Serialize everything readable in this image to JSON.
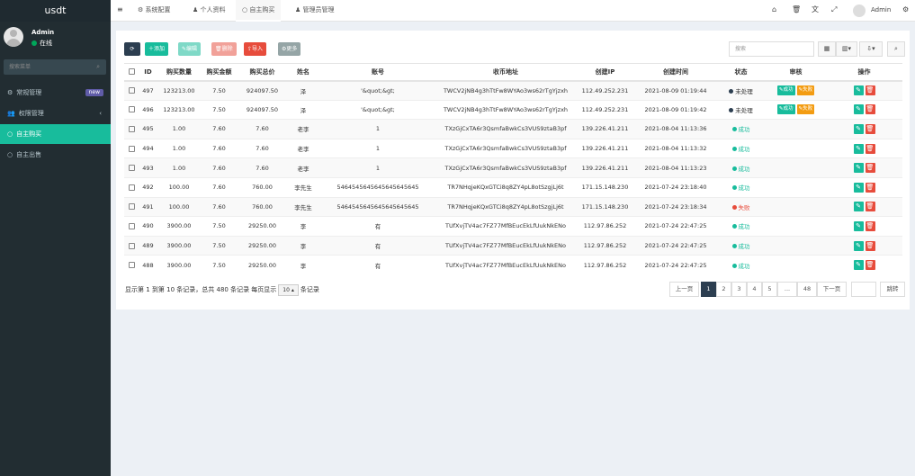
{
  "sidebar": {
    "logo": "usdt",
    "user": {
      "name": "Admin",
      "status": "在线"
    },
    "search_placeholder": "搜索菜单",
    "menu": [
      {
        "label": "常规管理",
        "icon": "gears-icon",
        "badge": "new"
      },
      {
        "label": "权限管理",
        "icon": "users-icon"
      },
      {
        "label": "自主购买",
        "icon": "circle-icon"
      },
      {
        "label": "自主出售",
        "icon": "circle-icon"
      }
    ]
  },
  "topnav": {
    "tabs": [
      {
        "label": "系统配置",
        "icon": "gear-icon"
      },
      {
        "label": "个人资料",
        "icon": "user-icon"
      },
      {
        "label": "自主购买",
        "icon": "circle-icon"
      },
      {
        "label": "管理员管理",
        "icon": "user-icon"
      }
    ],
    "admin_name": "Admin"
  },
  "toolbar": {
    "refresh": "⟳",
    "add": "添加",
    "edit": "编辑",
    "delete": "删除",
    "import": "导入",
    "more": "更多",
    "search_placeholder": "搜索"
  },
  "table": {
    "headers": [
      "ID",
      "购买数量",
      "购买金额",
      "购买总价",
      "姓名",
      "账号",
      "收币地址",
      "创建IP",
      "创建时间",
      "状态",
      "审核",
      "操作"
    ],
    "rows": [
      {
        "id": "497",
        "qty": "123213.00",
        "price": "7.50",
        "total": "924097.50",
        "name": "泽",
        "account": "'&quot;&gt;",
        "addr": "TWCV2jNB4g3hTtFw8WYAo3ws62rTgYjzxh",
        "ip": "112.49.252.231",
        "time": "2021-08-09 01:19:44",
        "status": "未处理",
        "status_color": "#2c3e50",
        "review": true
      },
      {
        "id": "496",
        "qty": "123213.00",
        "price": "7.50",
        "total": "924097.50",
        "name": "泽",
        "account": "'&quot;&gt;",
        "addr": "TWCV2jNB4g3hTtFw8WYAo3ws62rTgYjzxh",
        "ip": "112.49.252.231",
        "time": "2021-08-09 01:19:42",
        "status": "未处理",
        "status_color": "#2c3e50",
        "review": true
      },
      {
        "id": "495",
        "qty": "1.00",
        "price": "7.60",
        "total": "7.60",
        "name": "老李",
        "account": "1",
        "addr": "TXzGjCxTA6r3QsmfaBwkCs3VUS9ztaB3pf",
        "ip": "139.226.41.211",
        "time": "2021-08-04 11:13:36",
        "status": "成功",
        "status_color": "#18bc9c",
        "review": false
      },
      {
        "id": "494",
        "qty": "1.00",
        "price": "7.60",
        "total": "7.60",
        "name": "老李",
        "account": "1",
        "addr": "TXzGjCxTA6r3QsmfaBwkCs3VUS9ztaB3pf",
        "ip": "139.226.41.211",
        "time": "2021-08-04 11:13:32",
        "status": "成功",
        "status_color": "#18bc9c",
        "review": false
      },
      {
        "id": "493",
        "qty": "1.00",
        "price": "7.60",
        "total": "7.60",
        "name": "老李",
        "account": "1",
        "addr": "TXzGjCxTA6r3QsmfaBwkCs3VUS9ztaB3pf",
        "ip": "139.226.41.211",
        "time": "2021-08-04 11:13:23",
        "status": "成功",
        "status_color": "#18bc9c",
        "review": false
      },
      {
        "id": "492",
        "qty": "100.00",
        "price": "7.60",
        "total": "760.00",
        "name": "李先生",
        "account": "5464545645645645645645",
        "addr": "TR7NHqjeKQxGTCi8q8ZY4pL8otSzgjLj6t",
        "ip": "171.15.148.230",
        "time": "2021-07-24 23:18:40",
        "status": "成功",
        "status_color": "#18bc9c",
        "review": false
      },
      {
        "id": "491",
        "qty": "100.00",
        "price": "7.60",
        "total": "760.00",
        "name": "李先生",
        "account": "5464545645645645645645",
        "addr": "TR7NHqjeKQxGTCi8q8ZY4pL8otSzgjLj6t",
        "ip": "171.15.148.230",
        "time": "2021-07-24 23:18:34",
        "status": "失败",
        "status_color": "#e74c3c",
        "review": false
      },
      {
        "id": "490",
        "qty": "3900.00",
        "price": "7.50",
        "total": "29250.00",
        "name": "李",
        "account": "有",
        "addr": "TUfXvjTV4ac7FZ77MfBEucEkLfUukNkENo",
        "ip": "112.97.86.252",
        "time": "2021-07-24 22:47:25",
        "status": "成功",
        "status_color": "#18bc9c",
        "review": false
      },
      {
        "id": "489",
        "qty": "3900.00",
        "price": "7.50",
        "total": "29250.00",
        "name": "李",
        "account": "有",
        "addr": "TUfXvjTV4ac7FZ77MfBEucEkLfUukNkENo",
        "ip": "112.97.86.252",
        "time": "2021-07-24 22:47:25",
        "status": "成功",
        "status_color": "#18bc9c",
        "review": false
      },
      {
        "id": "488",
        "qty": "3900.00",
        "price": "7.50",
        "total": "29250.00",
        "name": "李",
        "account": "有",
        "addr": "TUfXvjTV4ac7FZ77MfBEucEkLfUukNkENo",
        "ip": "112.97.86.252",
        "time": "2021-07-24 22:47:25",
        "status": "成功",
        "status_color": "#18bc9c",
        "review": false
      }
    ],
    "review_success": "成功",
    "review_fail": "失败"
  },
  "pager": {
    "info_pre": "显示第 1 到第 10 条记录，总共 480 条记录 每页显示",
    "page_size": "10",
    "info_post": "条记录",
    "prev": "上一页",
    "pages": [
      "1",
      "2",
      "3",
      "4",
      "5",
      "...",
      "48"
    ],
    "next": "下一页",
    "jump": "跳转"
  },
  "colors": {
    "accent": "#18bc9c",
    "sidebar_bg": "#222d32",
    "danger": "#e74c3c",
    "warning": "#f39c12"
  }
}
